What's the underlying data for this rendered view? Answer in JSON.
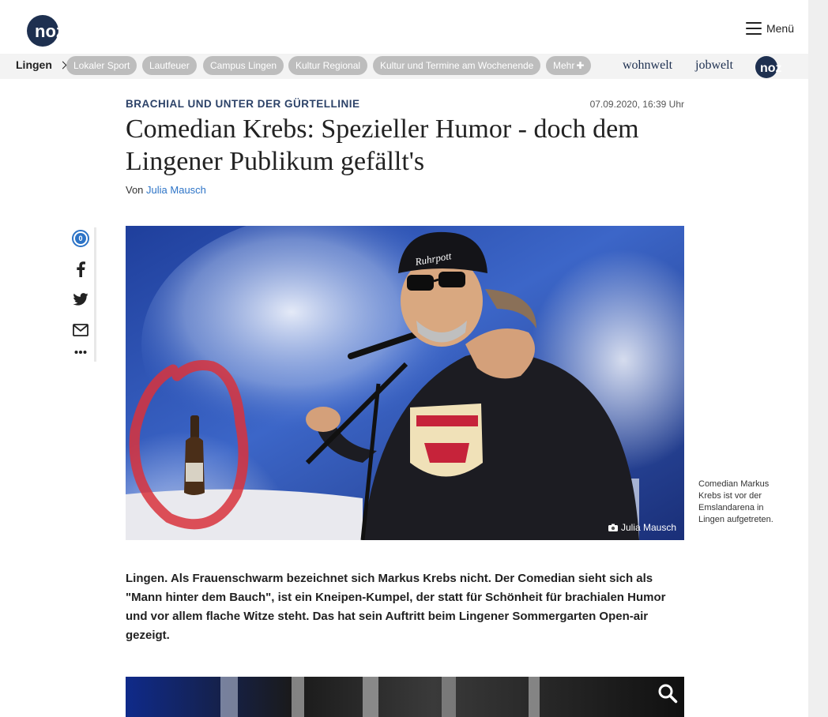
{
  "header": {
    "logo": "noz",
    "menu_label": "Menü"
  },
  "nav": {
    "home": "Lingen",
    "pills": [
      "Lokaler Sport",
      "Lautfeuer",
      "Campus Lingen",
      "Kultur Regional",
      "Kultur und Termine am Wochenende"
    ],
    "more": "Mehr",
    "brands": [
      "wohnwelt",
      "jobwelt"
    ],
    "logo_small": "noz"
  },
  "article": {
    "kicker": "BRACHIAL UND UNTER DER GÜRTELLINIE",
    "date": "07.09.2020, 16:39 Uhr",
    "headline": "Comedian Krebs: Spezieller Humor - doch dem Lingener Publikum gefällt's",
    "byline_prefix": "Von",
    "author": "Julia Mausch",
    "comment_count": "0",
    "photo_credit": "Julia Mausch",
    "beanie_text": "Ruhrpott",
    "caption": "Comedian Markus Krebs ist vor der Emslandarena in Lingen aufgetreten.",
    "lead": "Lingen. Als Frauenschwarm bezeichnet sich Markus Krebs nicht. Der Comedian sieht sich als \"Mann hinter dem Bauch\", ist ein Kneipen-Kumpel, der statt für Schönheit für brachialen Humor und vor allem flache Witze steht. Das hat sein Auftritt beim Lingener Sommergarten Open-air gezeigt."
  },
  "colors": {
    "brand_navy": "#1e3050",
    "link_blue": "#2d74c7",
    "pill_gray": "#bdbdbd",
    "annotation_red": "#d8333c"
  },
  "icons": [
    "comments-icon",
    "facebook-icon",
    "twitter-icon",
    "mail-icon",
    "more-icon",
    "camera-icon",
    "zoom-icon",
    "hamburger-icon"
  ]
}
